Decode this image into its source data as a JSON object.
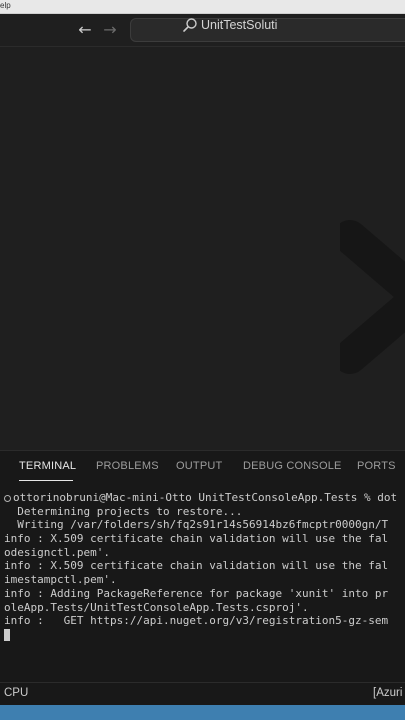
{
  "menubar": {
    "text": "elp"
  },
  "titlebar": {
    "command_center_label": "UnitTestSoluti"
  },
  "panel": {
    "tabs": [
      {
        "label": "TERMINAL",
        "active": true
      },
      {
        "label": "PROBLEMS",
        "active": false
      },
      {
        "label": "OUTPUT",
        "active": false
      },
      {
        "label": "DEBUG CONSOLE",
        "active": false
      },
      {
        "label": "PORTS",
        "active": false
      }
    ]
  },
  "terminal": {
    "prompt_line": "ottorinobruni@Mac-mini-Otto UnitTestConsoleApp.Tests % dot",
    "lines": [
      "  Determining projects to restore...",
      "  Writing /var/folders/sh/fq2s91r14s56914bz6fmcptr0000gn/T",
      "info : X.509 certificate chain validation will use the fal",
      "odesignctl.pem'.",
      "info : X.509 certificate chain validation will use the fal",
      "imestampctl.pem'.",
      "info : Adding PackageReference for package 'xunit' into pr",
      "oleApp.Tests/UnitTestConsoleApp.Tests.csproj'.",
      "info :   GET https://api.nuget.org/v3/registration5-gz-sem"
    ]
  },
  "statusbar": {
    "left": "CPU",
    "right": "[Azuri"
  },
  "colors": {
    "background": "#1e1e1e",
    "panel": "#181818",
    "dock": "#3e7fb0"
  }
}
